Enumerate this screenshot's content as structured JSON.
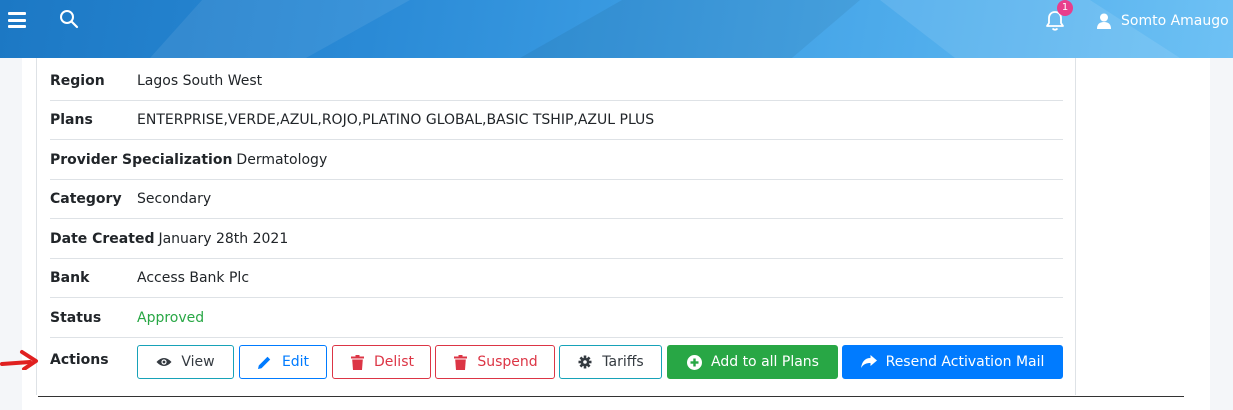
{
  "header": {
    "notification_count": "1",
    "user_name": "Somto Amaugo",
    "icons": [
      "menu-icon",
      "search-icon",
      "bell-icon",
      "user-icon"
    ]
  },
  "details": {
    "region": {
      "label": "Region",
      "value": "Lagos South West"
    },
    "plans": {
      "label": "Plans",
      "value": "ENTERPRISE,VERDE,AZUL,ROJO,PLATINO GLOBAL,BASIC TSHIP,AZUL PLUS"
    },
    "specialization": {
      "label": "Provider Specialization",
      "value": "Dermatology"
    },
    "category": {
      "label": "Category",
      "value": "Secondary"
    },
    "date_created": {
      "label": "Date Created",
      "value": "January 28th 2021"
    },
    "bank": {
      "label": "Bank",
      "value": "Access Bank Plc"
    },
    "status": {
      "label": "Status",
      "value": "Approved"
    }
  },
  "actions": {
    "label": "Actions",
    "buttons": {
      "view": "View",
      "edit": "Edit",
      "delist": "Delist",
      "suspend": "Suspend",
      "tariffs": "Tariffs",
      "add_to_all_plans": "Add to all Plans",
      "resend_activation_mail": "Resend Activation Mail"
    }
  },
  "colors": {
    "header_start": "#1c78c4",
    "header_end": "#6ec1f4",
    "success": "#28a745",
    "primary": "#007bff",
    "danger": "#dc3545",
    "info": "#17a2b8",
    "badge": "#e83e8c",
    "annotation_arrow": "#e02020"
  }
}
